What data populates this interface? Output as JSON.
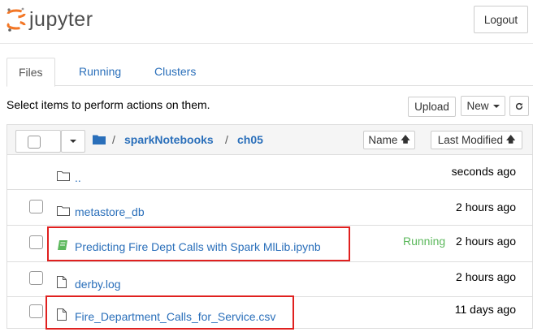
{
  "header": {
    "brand": "jupyter",
    "logout_label": "Logout"
  },
  "tabs": [
    {
      "label": "Files",
      "active": true
    },
    {
      "label": "Running",
      "active": false
    },
    {
      "label": "Clusters",
      "active": false
    }
  ],
  "toolbar": {
    "instructions": "Select items to perform actions on them.",
    "upload_label": "Upload",
    "new_label": "New",
    "refresh_icon": "refresh-icon"
  },
  "breadcrumb": {
    "separator": "/",
    "items": [
      "sparkNotebooks",
      "ch05"
    ]
  },
  "sort": {
    "name_label": "Name",
    "modified_label": "Last Modified"
  },
  "files": [
    {
      "name": "..",
      "type": "folder",
      "modified": "seconds ago",
      "status": ""
    },
    {
      "name": "metastore_db",
      "type": "folder",
      "modified": "2 hours ago",
      "status": ""
    },
    {
      "name": "Predicting Fire Dept Calls with Spark MlLib.ipynb",
      "type": "notebook",
      "modified": "2 hours ago",
      "status": "Running"
    },
    {
      "name": "derby.log",
      "type": "file",
      "modified": "2 hours ago",
      "status": ""
    },
    {
      "name": "Fire_Department_Calls_for_Service.csv",
      "type": "file",
      "modified": "11 days ago",
      "status": ""
    }
  ],
  "colors": {
    "link": "#2a6fba",
    "running": "#5cb85c",
    "highlight": "#e0201f",
    "logo_orange": "#f37726"
  }
}
